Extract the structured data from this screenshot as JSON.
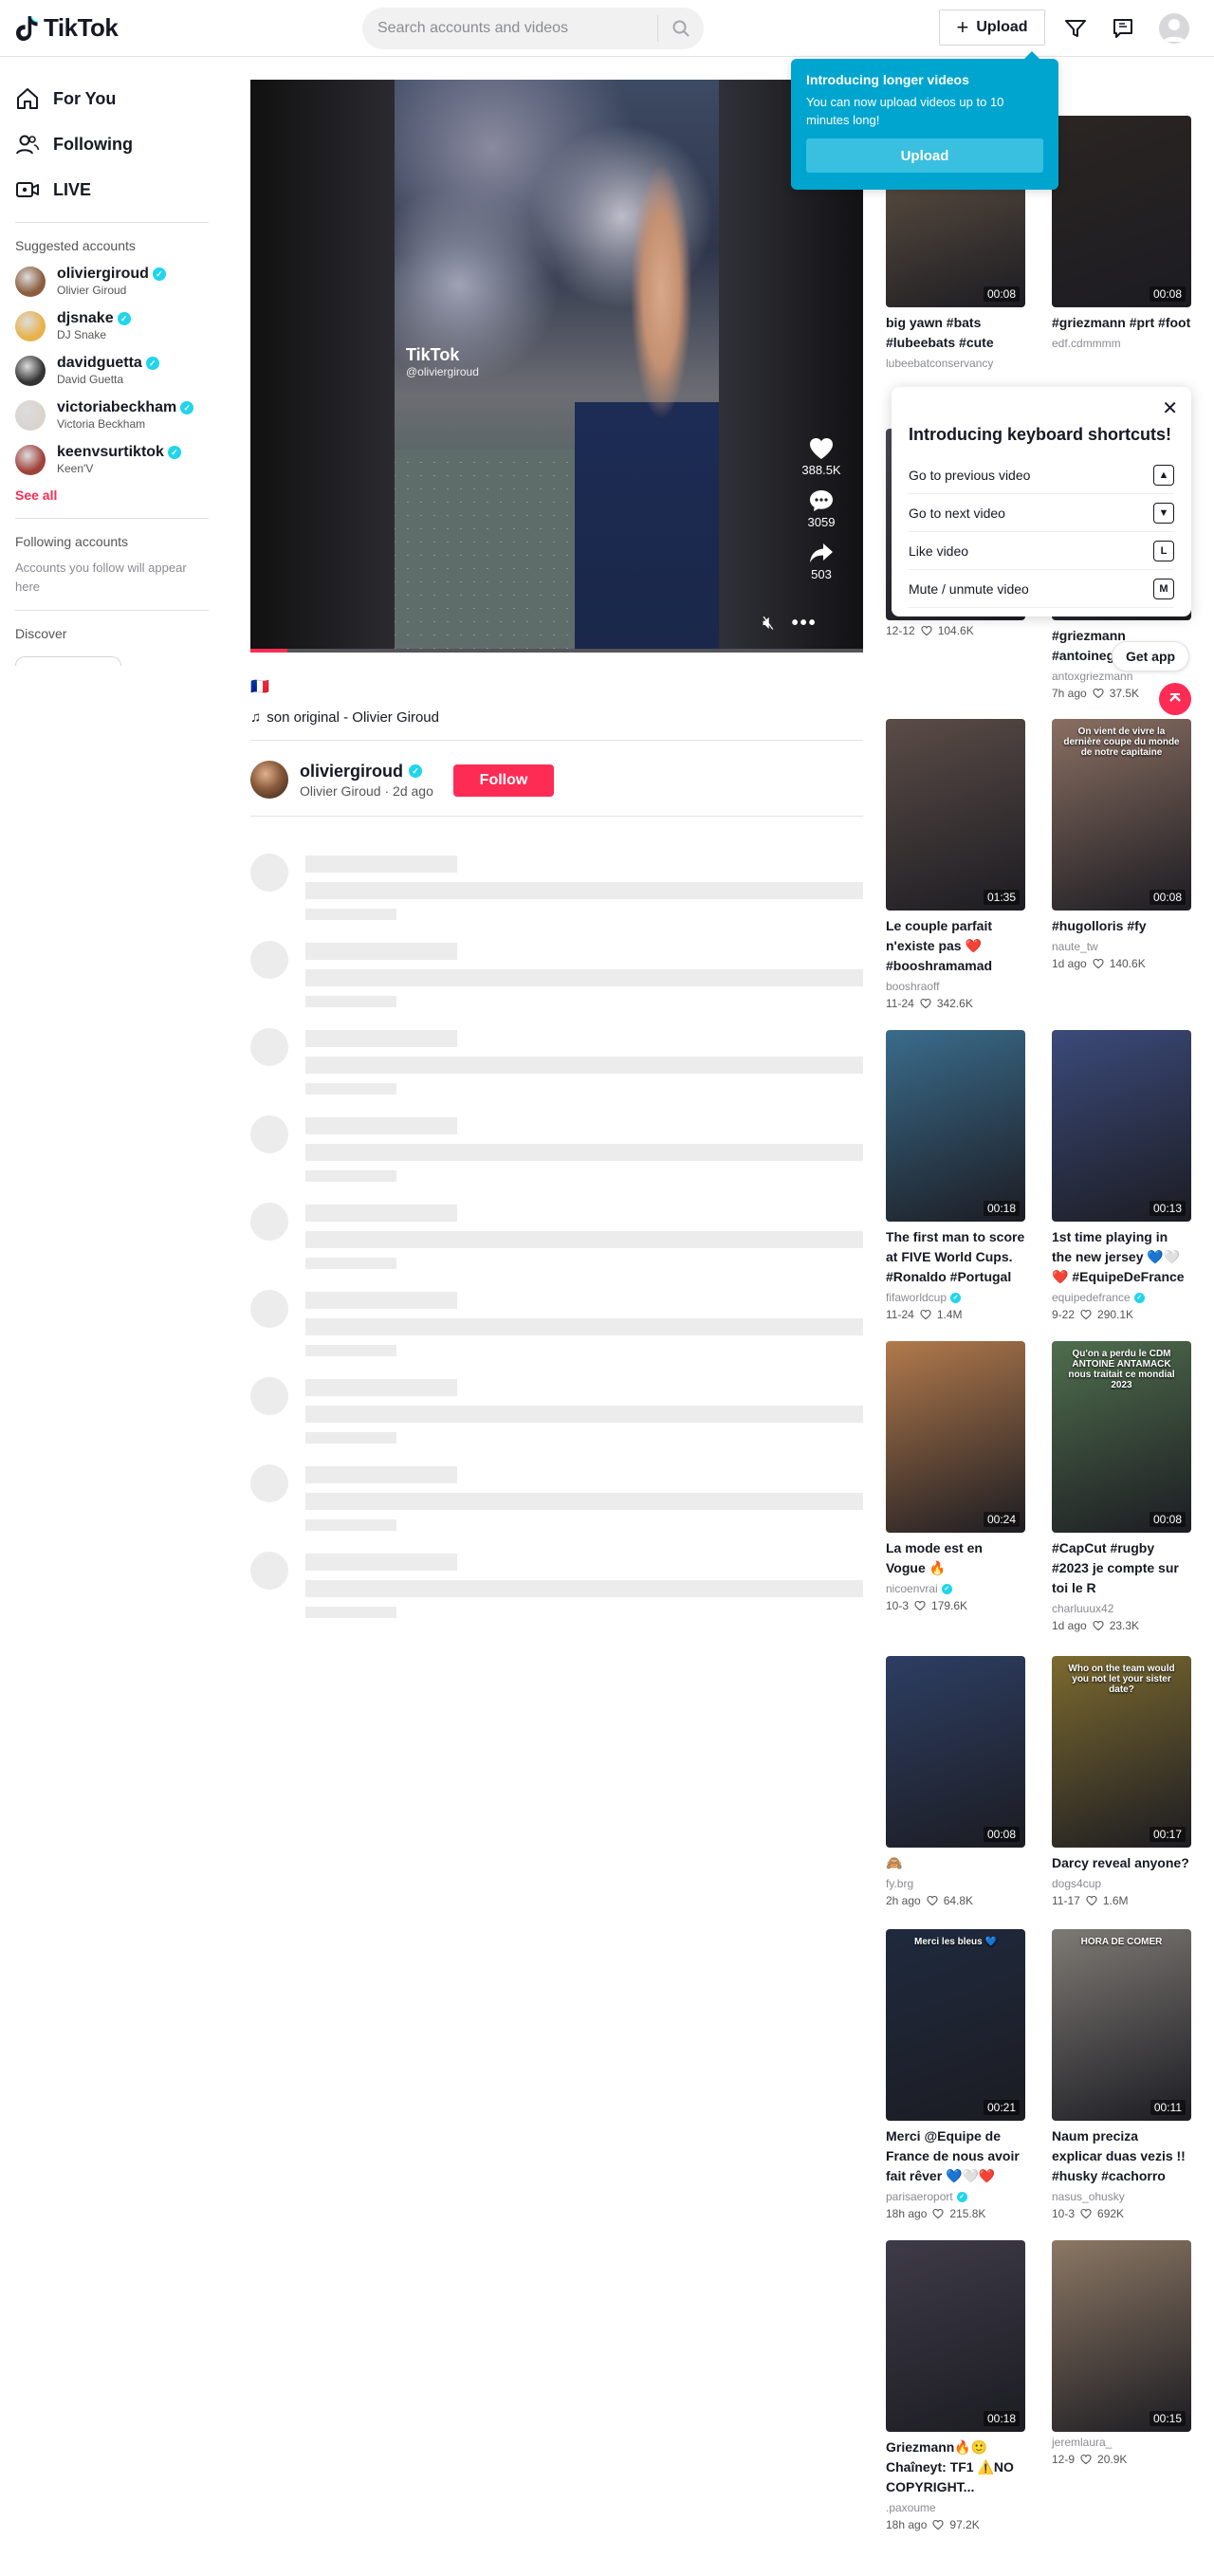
{
  "header": {
    "logo_text": "TikTok",
    "search_placeholder": "Search accounts and videos",
    "upload_label": "Upload"
  },
  "sidebar": {
    "nav": [
      {
        "label": "For You",
        "icon": "home-icon"
      },
      {
        "label": "Following",
        "icon": "users-icon"
      },
      {
        "label": "LIVE",
        "icon": "live-icon"
      }
    ],
    "suggested_title": "Suggested accounts",
    "accounts": [
      {
        "username": "oliviergiroud",
        "name": "Olivier Giroud",
        "color": "#8b5c3d"
      },
      {
        "username": "djsnake",
        "name": "DJ Snake",
        "color": "#e8b24a"
      },
      {
        "username": "davidguetta",
        "name": "David Guetta",
        "color": "#333333"
      },
      {
        "username": "victoriabeckham",
        "name": "Victoria Beckham",
        "color": "#d9d4cf"
      },
      {
        "username": "keenvsurtiktok",
        "name": "Keen'V",
        "color": "#a0413a"
      }
    ],
    "see_all": "See all",
    "following_title": "Following accounts",
    "following_note": "Accounts you follow will appear here",
    "discover_title": "Discover"
  },
  "video": {
    "watermark": "TikTok",
    "watermark_user": "@oliviergiroud",
    "likes": "388.5K",
    "comments": "3059",
    "shares": "503",
    "progress": 0.06,
    "flag": "🇫🇷",
    "music": "son original - Olivier Giroud",
    "author_username": "oliviergiroud",
    "author_name": "Olivier Giroud",
    "author_date": "2d ago",
    "follow_label": "Follow"
  },
  "upload_tip": {
    "title": "Introducing longer videos",
    "body": "You can now upload videos up to 10 minutes long!",
    "button": "Upload"
  },
  "shortcuts": {
    "title": "Introducing keyboard shortcuts!",
    "rows": [
      {
        "label": "Go to previous video",
        "key": "▲"
      },
      {
        "label": "Go to next video",
        "key": "▼"
      },
      {
        "label": "Like video",
        "key": "L"
      },
      {
        "label": "Mute / unmute video",
        "key": "M"
      }
    ]
  },
  "get_app": "Get app",
  "feed": [
    {
      "title": "big yawn #bats #lubeebats #cute",
      "user": "lubeebatconservancy",
      "verified": false,
      "date": "",
      "likes": "",
      "duration": "00:08",
      "color": "#6b5a48"
    },
    {
      "title": "#griezmann #prt #foot",
      "user": "edf.cdmmmm",
      "verified": false,
      "date": "",
      "likes": "",
      "duration": "00:08",
      "color": "#2b2522"
    },
    {
      "title": "",
      "user": "",
      "verified": false,
      "date": "12-12",
      "likes": "104.6K",
      "duration": "",
      "color": "#4a4a55"
    },
    {
      "title": "#griezmann #antoinegriezmann",
      "user": "antoxgriezmann",
      "verified": false,
      "date": "7h ago",
      "likes": "37.5K",
      "duration": "",
      "color": "#3a5060"
    },
    {
      "title": "Le couple parfait n'existe pas ❤️ #booshramamad",
      "user": "booshraoff",
      "verified": false,
      "date": "11-24",
      "likes": "342.6K",
      "duration": "01:35",
      "color": "#5b4c47"
    },
    {
      "title": "#hugolloris #fy",
      "user": "naute_tw",
      "verified": false,
      "date": "1d ago",
      "likes": "140.6K",
      "duration": "00:08",
      "color": "#8a6f62",
      "caption": "On vient de vivre la dernière coupe du monde de notre capitaine"
    },
    {
      "title": "The first man to score at FIVE World Cups. #Ronaldo #Portugal",
      "user": "fifaworldcup",
      "verified": true,
      "date": "11-24",
      "likes": "1.4M",
      "duration": "00:18",
      "color": "#3a6c8c"
    },
    {
      "title": "1st time playing in the new jersey 💙🤍❤️ #EquipeDeFrance",
      "user": "equipedefrance",
      "verified": true,
      "date": "9-22",
      "likes": "290.1K",
      "duration": "00:13",
      "color": "#3b4a7a"
    },
    {
      "title": "La mode est en Vogue 🔥",
      "user": "nicoenvrai",
      "verified": true,
      "date": "10-3",
      "likes": "179.6K",
      "duration": "00:24",
      "color": "#b27a4c"
    },
    {
      "title": "#CapCut #rugby #2023 je compte sur toi le R",
      "user": "charluuux42",
      "verified": false,
      "date": "1d ago",
      "likes": "23.3K",
      "duration": "00:08",
      "color": "#4f6e4d",
      "caption": "Qu'on a perdu le CDM ANTOINE ANTAMACK nous traitait ce mondial 2023"
    },
    {
      "title": "🙈",
      "user": "fy.brg",
      "verified": false,
      "date": "2h ago",
      "likes": "64.8K",
      "duration": "00:08",
      "color": "#2d3e63"
    },
    {
      "title": "Darcy reveal anyone?",
      "user": "dogs4cup",
      "verified": false,
      "date": "11-17",
      "likes": "1.6M",
      "duration": "00:17",
      "color": "#7c6a2f",
      "caption": "Who on the team would you not let your sister date?"
    },
    {
      "title": "Merci @Equipe de France de nous avoir fait rêver 💙🤍❤️ #parisaeroport",
      "user": "parisaeroport",
      "verified": true,
      "date": "18h ago",
      "likes": "215.8K",
      "duration": "00:21",
      "color": "#1f2a3e",
      "caption": "Merci les bleus 💙"
    },
    {
      "title": "Naum preciza explicar duas vezis !! #husky #cachorro #humor",
      "user": "nasus_ohusky",
      "verified": false,
      "date": "10-3",
      "likes": "692K",
      "duration": "00:11",
      "color": "#7e7a74",
      "caption": "HORA DE COMER"
    },
    {
      "title": "Griezmann🔥🙂 Chaîneyt: TF1 ⚠️NO COPYRIGHT...",
      "user": ".paxoume",
      "verified": false,
      "date": "18h ago",
      "likes": "97.2K",
      "duration": "00:18",
      "color": "#3e3b48"
    },
    {
      "title": "",
      "user": "jeremlaura_",
      "verified": false,
      "date": "12-9",
      "likes": "20.9K",
      "duration": "00:15",
      "color": "#8c7864"
    }
  ],
  "colors": {
    "accent": "#fe2c55",
    "verified": "#20d5ec",
    "tooltip": "#00a5cf"
  }
}
